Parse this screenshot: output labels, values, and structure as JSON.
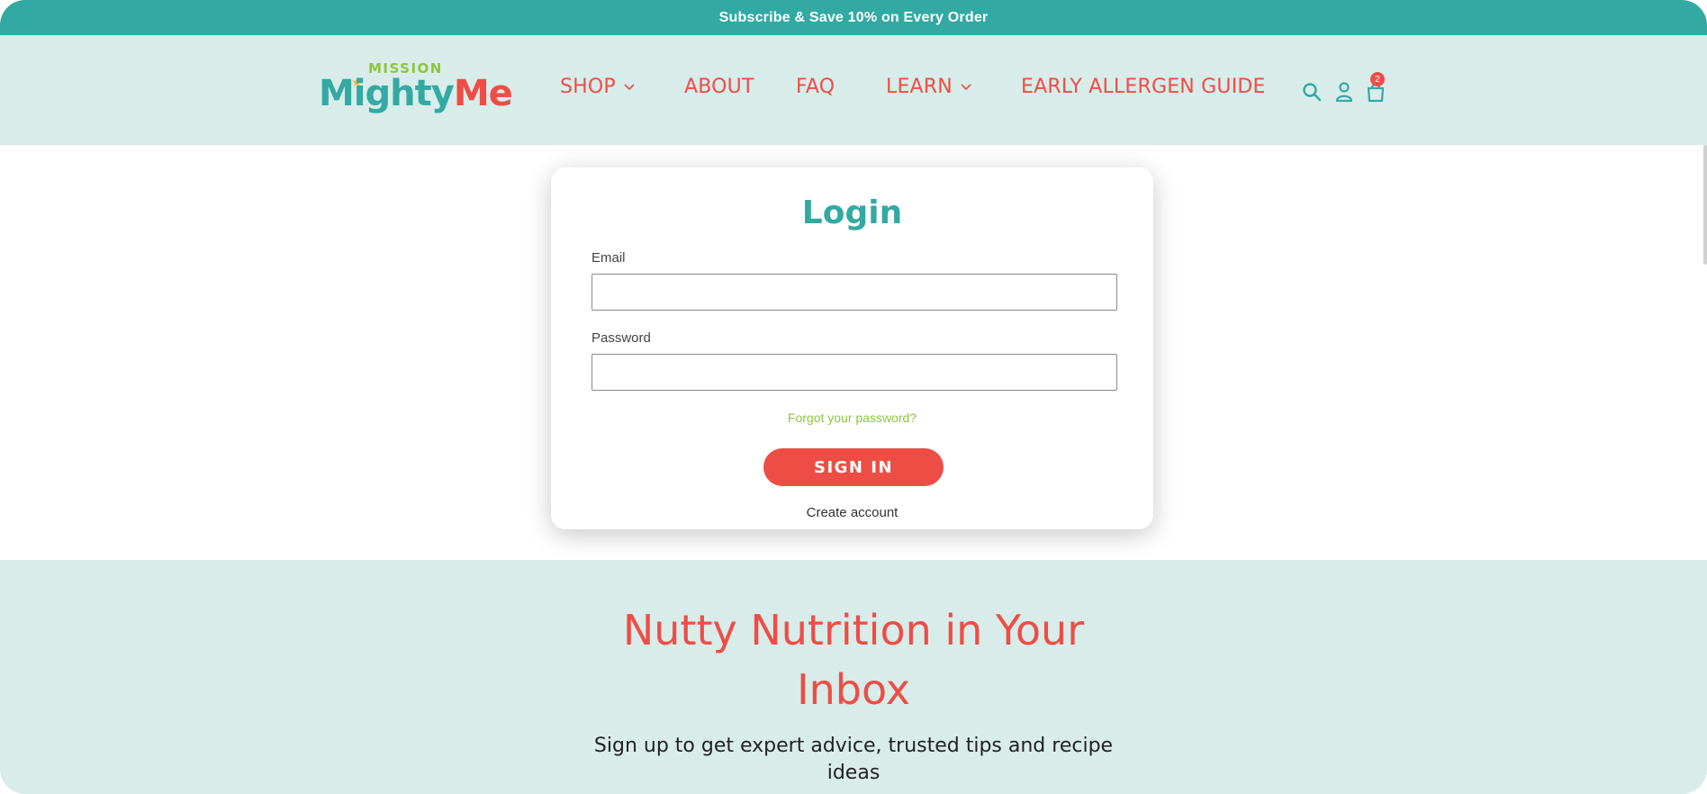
{
  "announcement": {
    "text": "Subscribe & Save 10% on Every Order"
  },
  "header": {
    "logo": {
      "top_word": "MISSION",
      "word_a": "Mighty",
      "word_b": "Me"
    },
    "nav": [
      {
        "label": "SHOP",
        "has_dropdown": true
      },
      {
        "label": "ABOUT",
        "has_dropdown": false
      },
      {
        "label": "FAQ",
        "has_dropdown": false
      },
      {
        "label": "LEARN",
        "has_dropdown": true
      },
      {
        "label": "EARLY ALLERGEN GUIDE",
        "has_dropdown": false
      }
    ],
    "icons": [
      "search-icon",
      "account-icon",
      "cart-icon"
    ],
    "cart_count": "2"
  },
  "login": {
    "title": "Login",
    "email_label": "Email",
    "email_value": "",
    "password_label": "Password",
    "password_value": "",
    "forgot_link": "Forgot your password?",
    "submit_label": "SIGN IN",
    "create_link": "Create account"
  },
  "newsletter": {
    "title": "Nutty Nutrition in Your Inbox",
    "subtitle": "Sign up to get expert advice, trusted tips and recipe ideas"
  },
  "colors": {
    "teal": "#33a9a3",
    "mint": "#d8ecea",
    "coral": "#ee4d46",
    "green": "#8cc63f"
  }
}
